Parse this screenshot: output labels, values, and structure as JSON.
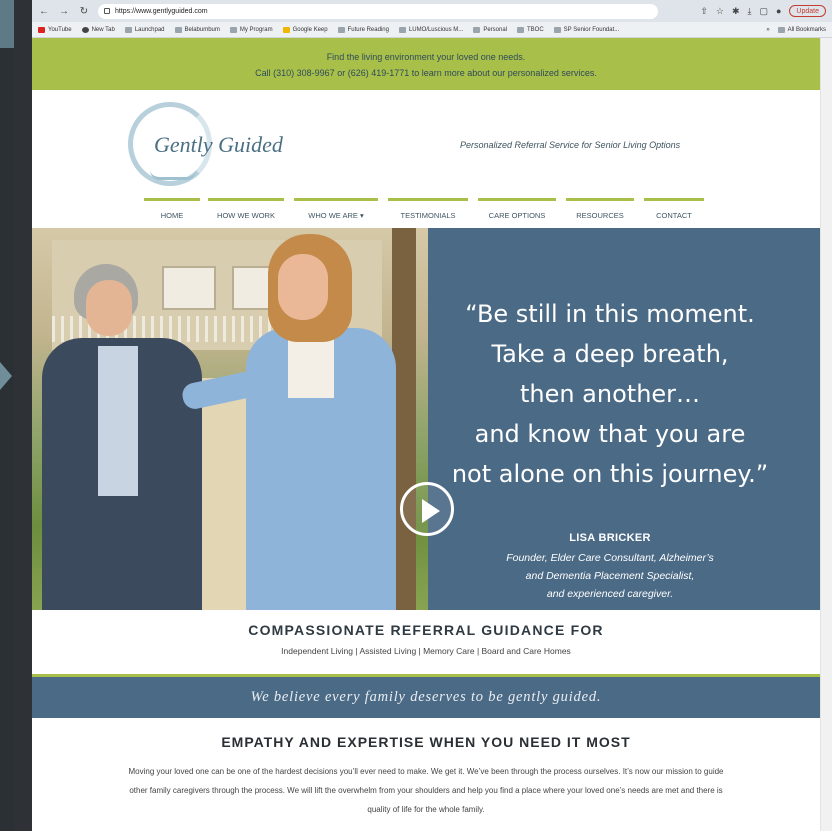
{
  "browser": {
    "url": "https://www.gentlyguided.com",
    "update_label": "Update",
    "bookmarks": [
      "YouTube",
      "New Tab",
      "Launchpad",
      "Belabumbum",
      "My Program",
      "Google Keep",
      "Future Reading",
      "LUMO/Luscious M...",
      "Personal",
      "TBOC",
      "SP Senior Foundat..."
    ],
    "all_bookmarks": "All Bookmarks"
  },
  "site": {
    "topbar": {
      "line1": "Find the living environment your loved one needs.",
      "line2": "Call (310) 308-9967 or (626) 419-1771 to learn more about our personalized services."
    },
    "logo": "Gently Guided",
    "tagline": "Personalized Referral Service for Senior Living Options",
    "nav": [
      {
        "label": "HOME"
      },
      {
        "label": "HOW WE WORK"
      },
      {
        "label": "WHO WE ARE ▾"
      },
      {
        "label": "TESTIMONIALS"
      },
      {
        "label": "CARE OPTIONS"
      },
      {
        "label": "RESOURCES"
      },
      {
        "label": "CONTACT"
      }
    ],
    "hero": {
      "quote_lines": [
        "“Be still in this moment.",
        "Take a deep breath,",
        "then another…",
        "and know that you are",
        "not alone on this journey.”"
      ],
      "name": "LISA BRICKER",
      "title_lines": [
        "Founder, Elder Care Consultant, Alzheimer’s",
        "and Dementia Placement Specialist,",
        "and experienced caregiver."
      ]
    },
    "referral": {
      "title": "COMPASSIONATE REFERRAL GUIDANCE FOR",
      "subtitle": "Independent Living | Assisted Living | Memory Care | Board and Care Homes"
    },
    "belief": "We believe every family deserves to be gently guided.",
    "empathy": {
      "title": "EMPATHY AND EXPERTISE WHEN YOU NEED IT MOST",
      "body": "Moving your loved one can be one of the hardest decisions you’ll ever need to make. We get it. We’ve been through the process ourselves. It’s now our mission to guide other family caregivers through the process. We will lift the overwhelm from your shoulders and help you find a place where your loved one’s needs are met and there is quality of life for the whole family."
    },
    "colors": {
      "accent_green": "#a8c04a",
      "slate_blue": "#4b6a86"
    }
  }
}
